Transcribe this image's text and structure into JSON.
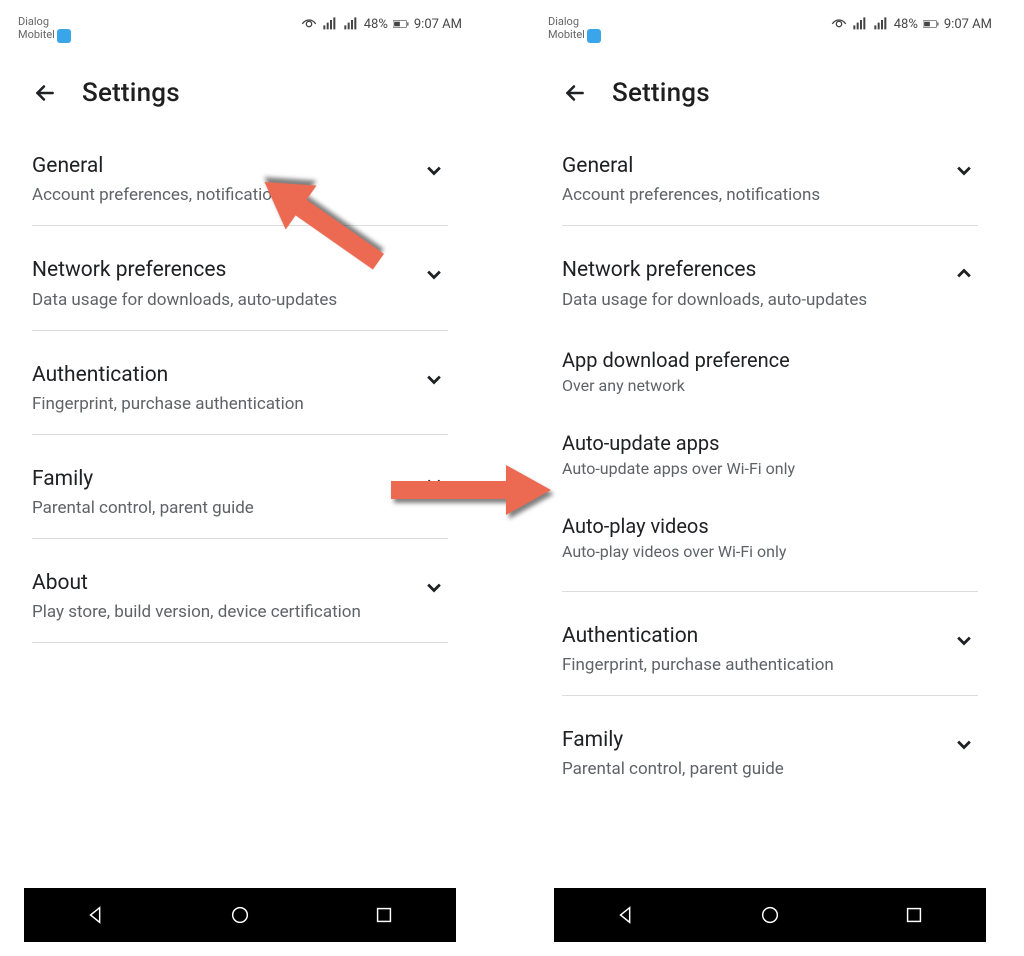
{
  "status": {
    "carrier1": "Dialog",
    "carrier2": "Mobitel",
    "battery": "48%",
    "time": "9:07 AM"
  },
  "header": {
    "title": "Settings"
  },
  "left": {
    "items": [
      {
        "title": "General",
        "subtitle": "Account preferences, notifications",
        "expanded": false
      },
      {
        "title": "Network preferences",
        "subtitle": "Data usage for downloads, auto-updates",
        "expanded": false
      },
      {
        "title": "Authentication",
        "subtitle": "Fingerprint, purchase authentication",
        "expanded": false
      },
      {
        "title": "Family",
        "subtitle": "Parental control, parent guide",
        "expanded": false
      },
      {
        "title": "About",
        "subtitle": "Play store, build version, device certification",
        "expanded": false
      }
    ]
  },
  "right": {
    "items": [
      {
        "title": "General",
        "subtitle": "Account preferences, notifications",
        "expanded": false
      },
      {
        "title": "Network preferences",
        "subtitle": "Data usage for downloads, auto-updates",
        "expanded": true,
        "children": [
          {
            "title": "App download preference",
            "subtitle": "Over any network"
          },
          {
            "title": "Auto-update apps",
            "subtitle": "Auto-update apps over Wi-Fi only"
          },
          {
            "title": "Auto-play videos",
            "subtitle": "Auto-play videos over Wi-Fi only"
          }
        ]
      },
      {
        "title": "Authentication",
        "subtitle": "Fingerprint, purchase authentication",
        "expanded": false
      },
      {
        "title": "Family",
        "subtitle": "Parental control, parent guide",
        "expanded": false
      }
    ]
  }
}
